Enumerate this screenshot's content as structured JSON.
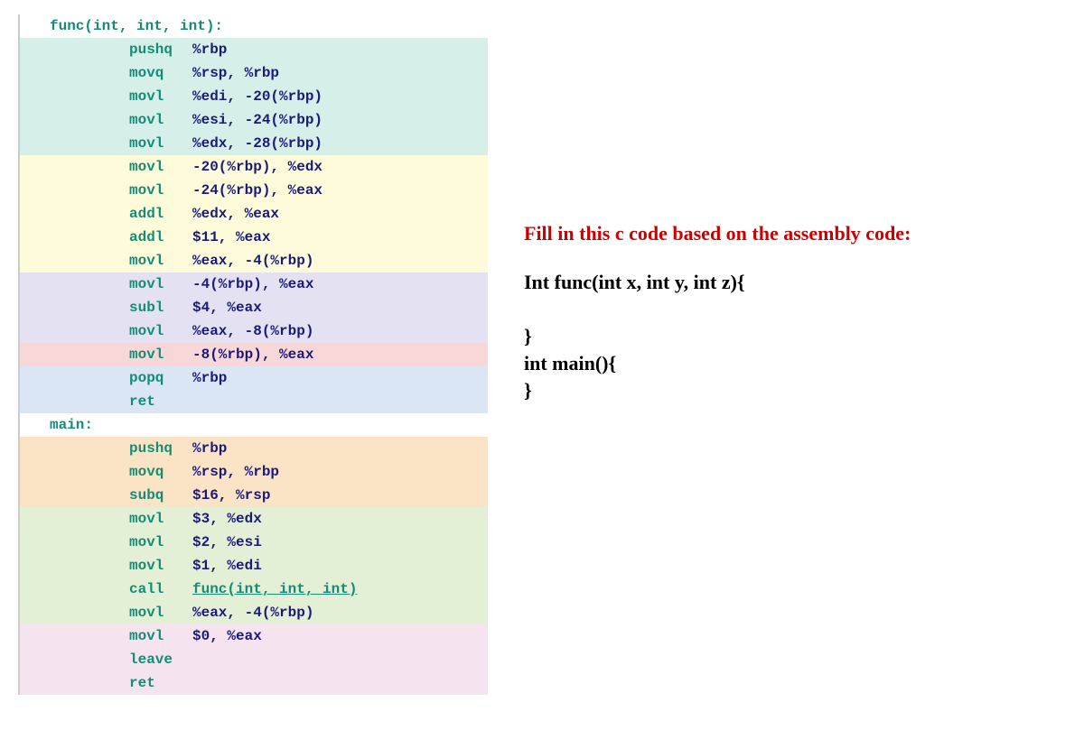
{
  "func_label": "func(int, int, int):",
  "func_lines": [
    {
      "bg": "bg-cyan",
      "mn": "pushq",
      "op": "%rbp"
    },
    {
      "bg": "bg-cyan",
      "mn": "movq",
      "op": "%rsp, %rbp"
    },
    {
      "bg": "bg-cyan",
      "mn": "movl",
      "op": "%edi, -20(%rbp)"
    },
    {
      "bg": "bg-cyan",
      "mn": "movl",
      "op": "%esi, -24(%rbp)"
    },
    {
      "bg": "bg-cyan",
      "mn": "movl",
      "op": "%edx, -28(%rbp)"
    },
    {
      "bg": "bg-yellow",
      "mn": "movl",
      "op": "-20(%rbp), %edx"
    },
    {
      "bg": "bg-yellow",
      "mn": "movl",
      "op": "-24(%rbp), %eax"
    },
    {
      "bg": "bg-yellow",
      "mn": "addl",
      "op": "%edx, %eax"
    },
    {
      "bg": "bg-yellow",
      "mn": "addl",
      "op": "$11, %eax"
    },
    {
      "bg": "bg-yellow",
      "mn": "movl",
      "op": "%eax, -4(%rbp)"
    },
    {
      "bg": "bg-purple",
      "mn": "movl",
      "op": "-4(%rbp), %eax"
    },
    {
      "bg": "bg-purple",
      "mn": "subl",
      "op": "$4, %eax"
    },
    {
      "bg": "bg-purple",
      "mn": "movl",
      "op": "%eax, -8(%rbp)"
    },
    {
      "bg": "bg-red",
      "mn": "movl",
      "op": "-8(%rbp), %eax"
    },
    {
      "bg": "bg-blue",
      "mn": "popq",
      "op": "%rbp"
    },
    {
      "bg": "bg-blue",
      "mn": "ret",
      "op": ""
    }
  ],
  "main_label": "main:",
  "main_lines": [
    {
      "bg": "bg-orange",
      "mn": "pushq",
      "op": "%rbp"
    },
    {
      "bg": "bg-orange",
      "mn": "movq",
      "op": "%rsp, %rbp"
    },
    {
      "bg": "bg-orange",
      "mn": "subq",
      "op": "$16, %rsp"
    },
    {
      "bg": "bg-green",
      "mn": "movl",
      "op": "$3, %edx"
    },
    {
      "bg": "bg-green",
      "mn": "movl",
      "op": "$2, %esi"
    },
    {
      "bg": "bg-green",
      "mn": "movl",
      "op": "$1, %edi"
    },
    {
      "bg": "bg-green",
      "mn": "call",
      "op": "func(int, int, int)",
      "call": true
    },
    {
      "bg": "bg-green",
      "mn": "movl",
      "op": "%eax, -4(%rbp)"
    },
    {
      "bg": "bg-pink",
      "mn": "movl",
      "op": "$0, %eax"
    },
    {
      "bg": "bg-pink",
      "mn": "leave",
      "op": ""
    },
    {
      "bg": "bg-pink",
      "mn": "ret",
      "op": ""
    }
  ],
  "prompt": "Fill in this c code based on the assembly code:",
  "c_lines": [
    "Int func(int x, int y, int z){",
    "",
    "}",
    "int main(){",
    "}"
  ]
}
